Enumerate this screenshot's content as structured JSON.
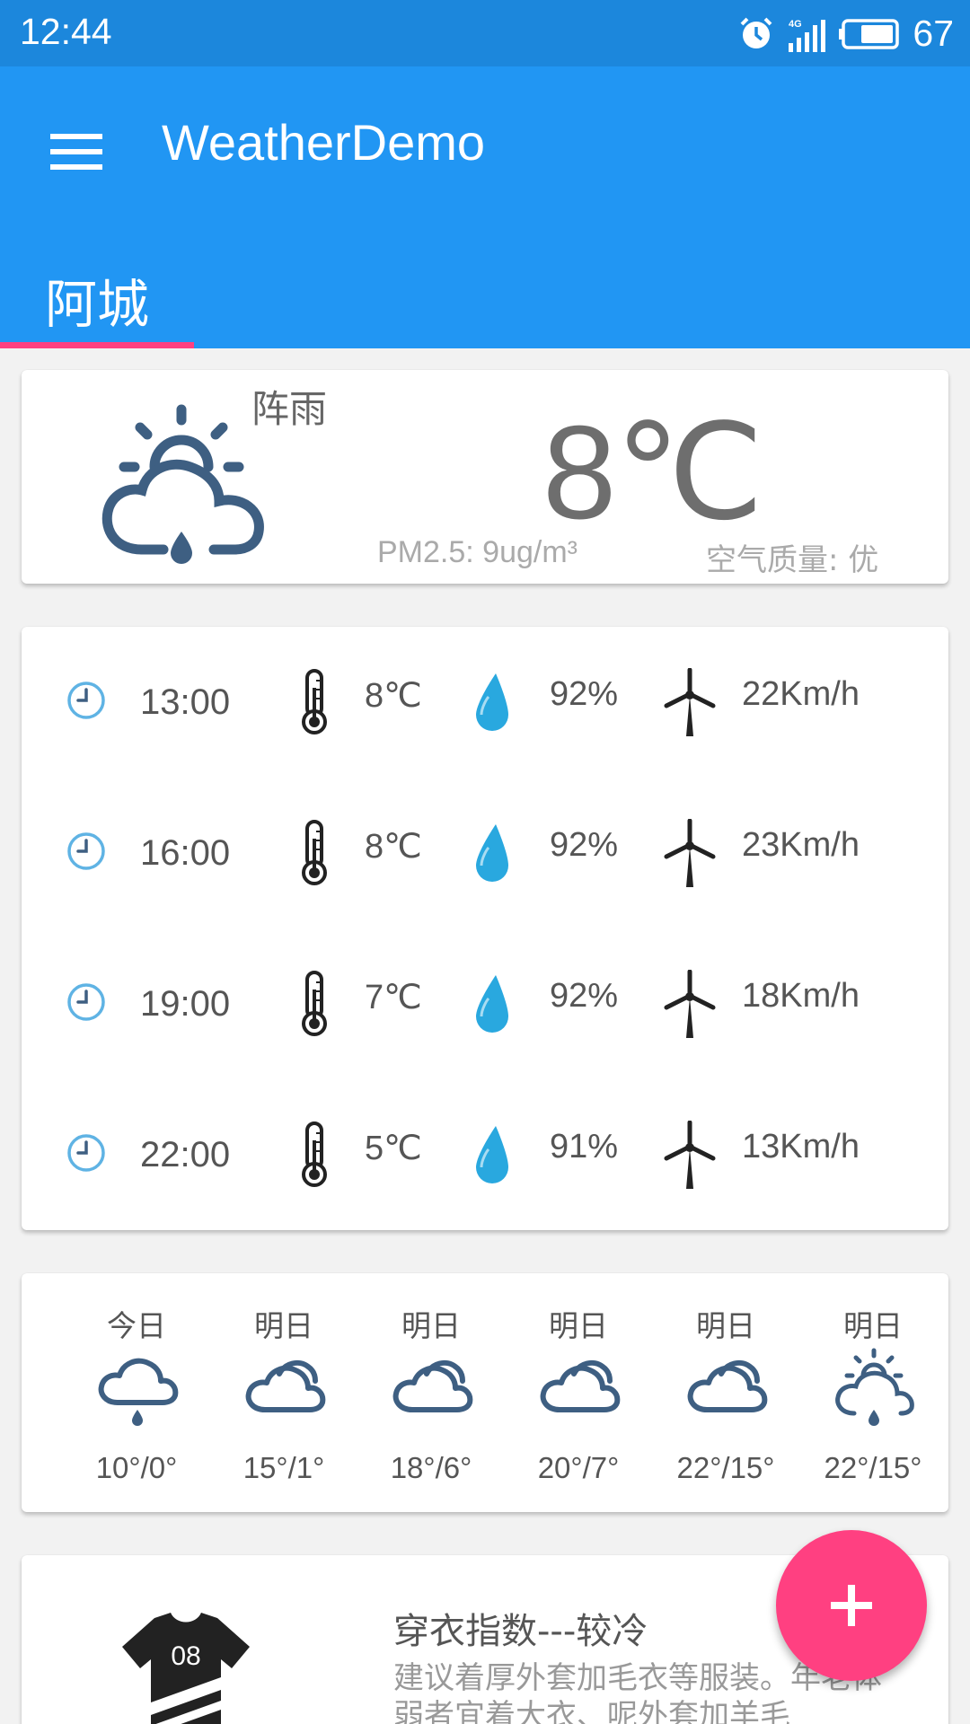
{
  "status_bar": {
    "time": "12:44",
    "battery": "67",
    "network": "4G"
  },
  "app_bar": {
    "title": "WeatherDemo"
  },
  "tabs": [
    {
      "label": "阿城",
      "selected": true
    }
  ],
  "current": {
    "description": "阵雨",
    "temperature": "8℃",
    "pm25": "PM2.5: 9ug/m³",
    "air_quality": "空气质量: 优",
    "icon": "partly-sunny-rain-icon"
  },
  "hourly": [
    {
      "time": "13:00",
      "temp": "8℃",
      "humidity": "92%",
      "wind": "22Km/h"
    },
    {
      "time": "16:00",
      "temp": "8℃",
      "humidity": "92%",
      "wind": "23Km/h"
    },
    {
      "time": "19:00",
      "temp": "7℃",
      "humidity": "92%",
      "wind": "18Km/h"
    },
    {
      "time": "22:00",
      "temp": "5℃",
      "humidity": "91%",
      "wind": "13Km/h"
    }
  ],
  "forecast": [
    {
      "label": "今日",
      "range": "10°/0°",
      "icon": "rain-cloud-icon"
    },
    {
      "label": "明日",
      "range": "15°/1°",
      "icon": "cloudy-icon"
    },
    {
      "label": "明日",
      "range": "18°/6°",
      "icon": "cloudy-icon"
    },
    {
      "label": "明日",
      "range": "20°/7°",
      "icon": "cloudy-icon"
    },
    {
      "label": "明日",
      "range": "22°/15°",
      "icon": "cloudy-icon"
    },
    {
      "label": "明日",
      "range": "22°/15°",
      "icon": "partly-sunny-rain-icon"
    }
  ],
  "clothing": {
    "title": "穿衣指数---较冷",
    "description": "建议着厚外套加毛衣等服装。年老体弱者宜着大衣、呢外套加羊毛",
    "shirt_number": "08"
  },
  "fab": {
    "label": "+"
  },
  "colors": {
    "primary": "#2196F3",
    "status_bar": "#1C87DC",
    "accent": "#FF4081",
    "icon_blue": "#3E5F82",
    "drop_blue": "#29A8DF"
  }
}
